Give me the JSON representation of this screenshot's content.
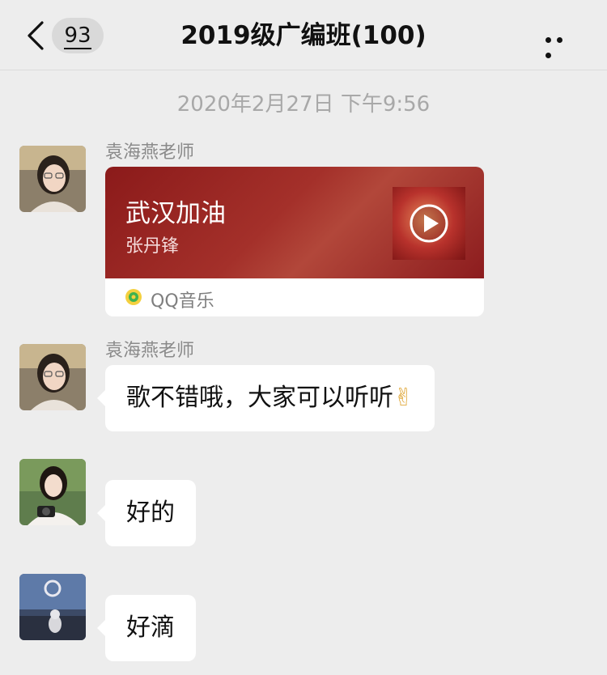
{
  "navbar": {
    "back_count": "93",
    "title": "2019级广编班(100)"
  },
  "timestamp": "2020年2月27日 下午9:56",
  "messages": [
    {
      "sender": "袁海燕老师",
      "card": {
        "title": "武汉加油",
        "artist": "张丹锋",
        "source": "QQ音乐"
      }
    },
    {
      "sender": "袁海燕老师",
      "text": "歌不错哦，大家可以听听",
      "emoji": "✌"
    },
    {
      "sender": "",
      "text": "好的"
    },
    {
      "sender": "",
      "text": "好滴"
    }
  ],
  "colors": {
    "background": "#ededed",
    "bubble": "#ffffff",
    "card_red": "#9b1f1f",
    "muted_text": "#8a8a8a"
  },
  "icons": [
    "back-arrow-icon",
    "more-icon",
    "play-icon",
    "qq-music-icon",
    "victory-hand-icon"
  ]
}
